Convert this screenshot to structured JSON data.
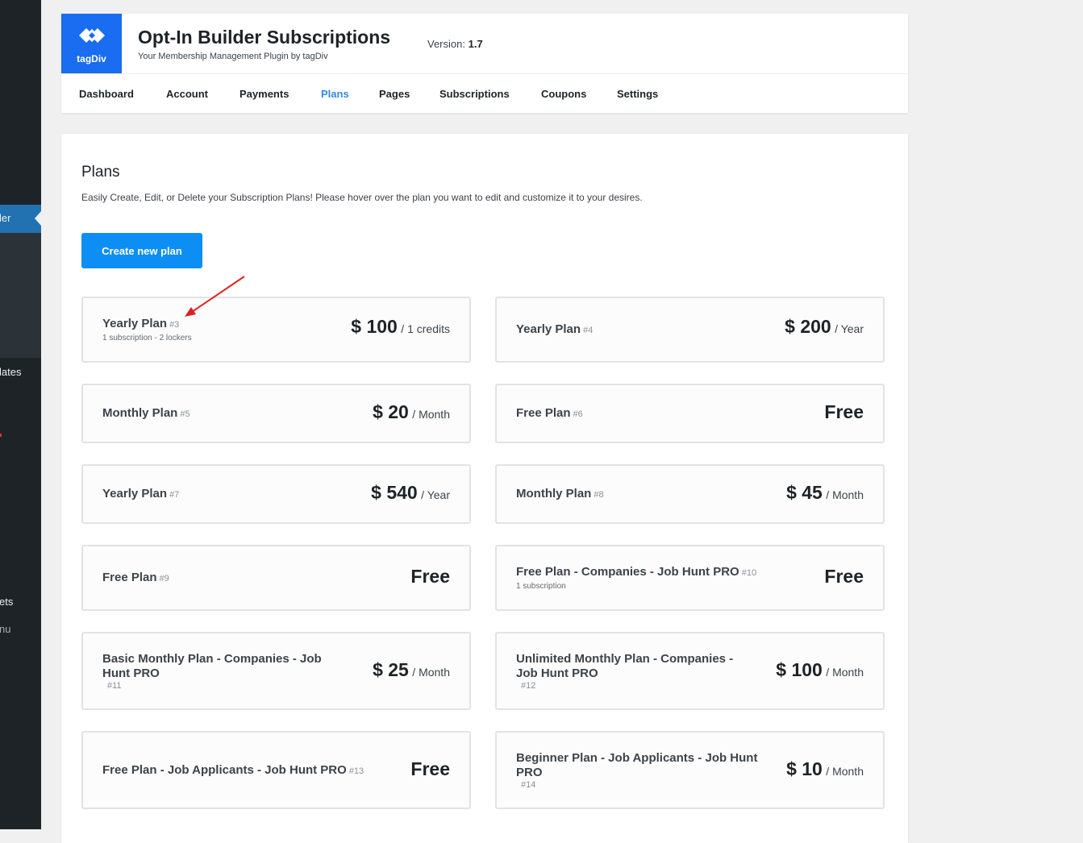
{
  "sidebar": {
    "items": [
      {
        "label": "ler"
      },
      {
        "label": "lates"
      },
      {
        "label": "ets"
      },
      {
        "label": "nu"
      }
    ]
  },
  "header": {
    "logo_text": "tagDiv",
    "title": "Opt-In Builder Subscriptions",
    "subtitle": "Your Membership Management Plugin by tagDiv",
    "version_label": "Version:",
    "version_value": "1.7",
    "accent_color": "#1a6cf0"
  },
  "nav": {
    "items": [
      "Dashboard",
      "Account",
      "Payments",
      "Plans",
      "Pages",
      "Subscriptions",
      "Coupons",
      "Settings"
    ],
    "active": "Plans"
  },
  "main": {
    "title": "Plans",
    "description": "Easily Create, Edit, or Delete your Subscription Plans! Please hover over the plan you want to edit and customize it to your desires.",
    "create_button": "Create new plan"
  },
  "plans": [
    {
      "name": "Yearly Plan",
      "id": "#3",
      "sub": "1 subscription - 2 lockers",
      "amount": "$ 100",
      "period": "/ 1 credits"
    },
    {
      "name": "Yearly Plan",
      "id": "#4",
      "amount": "$ 200",
      "period": "/ Year"
    },
    {
      "name": "Monthly Plan",
      "id": "#5",
      "amount": "$ 20",
      "period": "/ Month"
    },
    {
      "name": "Free Plan",
      "id": "#6",
      "free": "Free"
    },
    {
      "name": "Yearly Plan",
      "id": "#7",
      "amount": "$ 540",
      "period": "/ Year"
    },
    {
      "name": "Monthly Plan",
      "id": "#8",
      "amount": "$ 45",
      "period": "/ Month"
    },
    {
      "name": "Free Plan",
      "id": "#9",
      "free": "Free"
    },
    {
      "name": "Free Plan - Companies - Job Hunt PRO",
      "id": "#10",
      "sub": "1 subscription",
      "free": "Free"
    },
    {
      "name": "Basic Monthly Plan - Companies - Job Hunt PRO",
      "id": "#11",
      "amount": "$ 25",
      "period": "/ Month"
    },
    {
      "name": "Unlimited Monthly Plan - Companies - Job Hunt PRO",
      "id": "#12",
      "amount": "$ 100",
      "period": "/ Month"
    },
    {
      "name": "Free Plan - Job Applicants - Job Hunt PRO",
      "id": "#13",
      "free": "Free"
    },
    {
      "name": "Beginner Plan - Job Applicants - Job Hunt PRO",
      "id": "#14",
      "amount": "$ 10",
      "period": "/ Month"
    }
  ],
  "annotation_arrow_color": "#e02020"
}
